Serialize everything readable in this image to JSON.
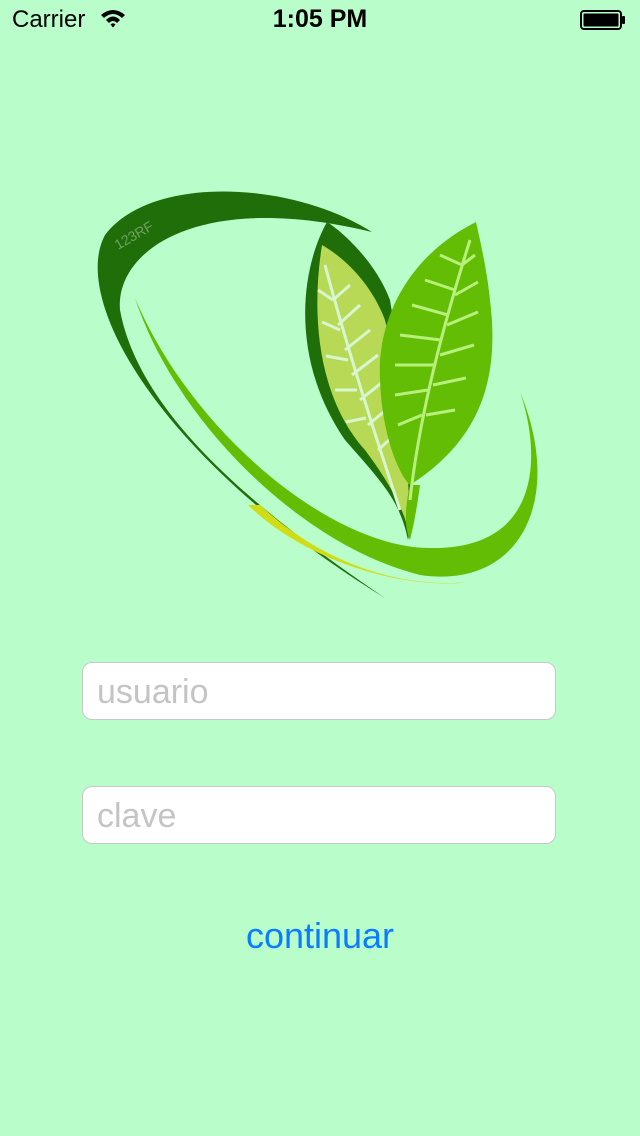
{
  "status_bar": {
    "carrier": "Carrier",
    "time": "1:05 PM",
    "wifi_icon": "wifi-icon",
    "battery_icon": "battery-icon"
  },
  "logo": {
    "icon": "leaf-logo-icon",
    "watermark": "123RF",
    "colors": {
      "dark_green": "#1f6e0a",
      "bright_green": "#63bd05",
      "light_green": "#b7d956",
      "yellow_green": "#d0dd16"
    }
  },
  "form": {
    "username_placeholder": "usuario",
    "password_placeholder": "clave",
    "continue_label": "continuar"
  },
  "colors": {
    "background": "#b9fdcb",
    "button": "#0a7cff",
    "placeholder": "#c4c4c4"
  }
}
